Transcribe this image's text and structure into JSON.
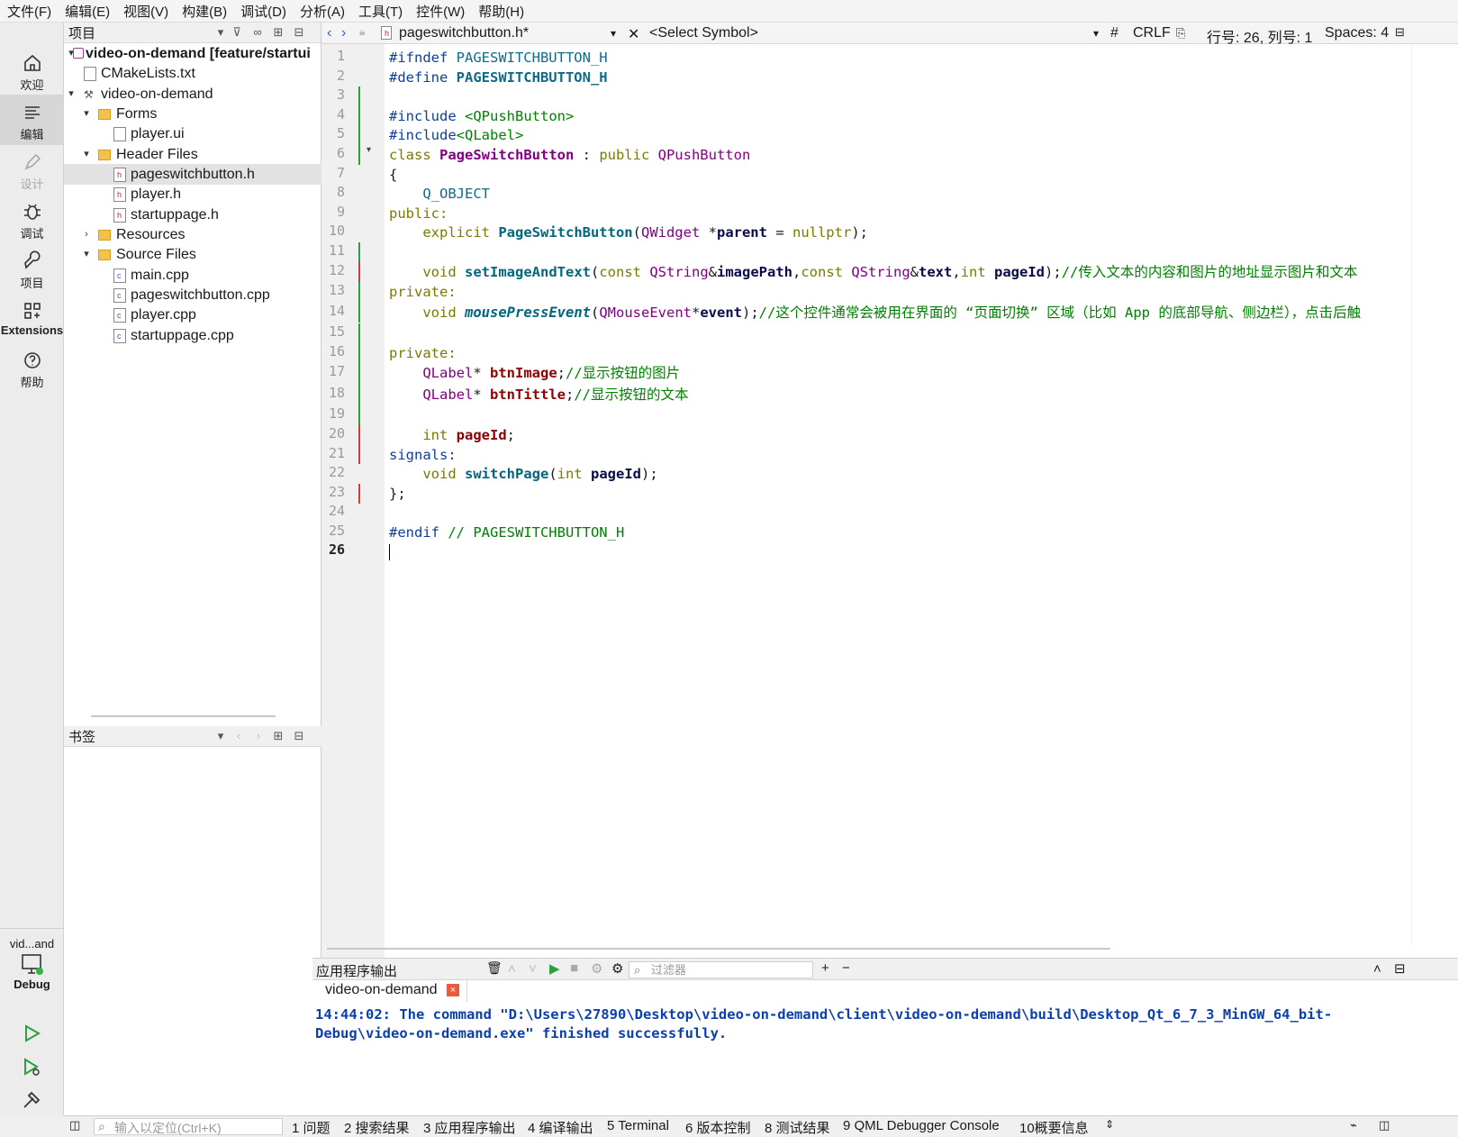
{
  "menu": [
    "文件(F)",
    "编辑(E)",
    "视图(V)",
    "构建(B)",
    "调试(D)",
    "分析(A)",
    "工具(T)",
    "控件(W)",
    "帮助(H)"
  ],
  "modes": [
    {
      "label": "欢迎"
    },
    {
      "label": "编辑"
    },
    {
      "label": "设计"
    },
    {
      "label": "调试"
    },
    {
      "label": "项目"
    },
    {
      "label": "Extensions"
    },
    {
      "label": "帮助"
    }
  ],
  "kit": {
    "project": "vid...and",
    "config": "Debug"
  },
  "project_pane": {
    "title": "项目"
  },
  "tree": [
    {
      "label": "video-on-demand [feature/startui"
    },
    {
      "label": "CMakeLists.txt"
    },
    {
      "label": "video-on-demand"
    },
    {
      "label": "Forms"
    },
    {
      "label": "player.ui"
    },
    {
      "label": "Header Files"
    },
    {
      "label": "pageswitchbutton.h"
    },
    {
      "label": "player.h"
    },
    {
      "label": "startuppage.h"
    },
    {
      "label": "Resources"
    },
    {
      "label": "Source Files"
    },
    {
      "label": "main.cpp"
    },
    {
      "label": "pageswitchbutton.cpp"
    },
    {
      "label": "player.cpp"
    },
    {
      "label": "startuppage.cpp"
    }
  ],
  "bookmarks": {
    "title": "书签"
  },
  "editor": {
    "file": "pageswitchbutton.h*",
    "symbol": "<Select Symbol>",
    "hash": "#",
    "eol": "CRLF",
    "position": "行号: 26, 列号: 1",
    "spaces": "Spaces: 4"
  },
  "lines": [
    "1",
    "2",
    "3",
    "4",
    "5",
    "6",
    "7",
    "8",
    "9",
    "10",
    "11",
    "12",
    "13",
    "14",
    "15",
    "16",
    "17",
    "18",
    "19",
    "20",
    "21",
    "22",
    "23",
    "24",
    "25",
    "26"
  ],
  "code": {
    "l1a": "#ifndef ",
    "l1b": "PAGESWITCHBUTTON_H",
    "l2a": "#define ",
    "l2b": "PAGESWITCHBUTTON_H",
    "l4a": "#include ",
    "l4b": "<QPushButton>",
    "l5a": "#include",
    "l5b": "<QLabel>",
    "l6a": "class ",
    "l6b": "PageSwitchButton",
    " l6c": " : ",
    "l6d": "public ",
    "l6e": "QPushButton",
    "l7": "{",
    "l8": "    Q_OBJECT",
    "l9": "public:",
    "l10a": "    explicit ",
    "l10b": "PageSwitchButton",
    "l10c": "(",
    "l10d": "QWidget",
    " l10e": " *",
    "l10f": "parent",
    " l10g": " = ",
    "l10h": "nullptr",
    "l10i": ");",
    "l12a": "    void ",
    "l12b": "setImageAndText",
    "l12c": "(",
    "l12d": "const ",
    "l12e": "QString",
    "l12f": "&",
    "l12g": "imagePath",
    "l12h": ",",
    "l12i": "const ",
    "l12j": "QString",
    "l12k": "&",
    "l12l": "text",
    "l12m": ",",
    "l12n": "int ",
    "l12o": "pageId",
    "l12p": ");",
    "l12q": "//传入文本的内容和图片的地址显示图片和文本",
    "l13": "private:",
    "l14a": "    void ",
    "l14b": "mousePressEvent",
    "l14c": "(",
    "l14d": "QMouseEvent",
    "l14e": "*",
    "l14f": "event",
    "l14g": ");",
    "l14h": "//这个控件通常会被用在界面的 “页面切换” 区域（比如 App 的底部导航、侧边栏），点击后触",
    "l16": "private:",
    "l17a": "    QLabel",
    "l17b": "* ",
    "l17c": "btnImage",
    "l17d": ";",
    "l17e": "//显示按钮的图片",
    "l18a": "    QLabel",
    "l18b": "* ",
    "l18c": "btnTittle",
    "l18d": ";",
    "l18e": "//显示按钮的文本",
    "l20a": "    int ",
    "l20b": "pageId",
    "l20c": ";",
    "l21": "signals:",
    "l22a": "    void ",
    "l22b": "switchPage",
    "l22c": "(",
    "l22d": "int ",
    "l22e": "pageId",
    "l22f": ");",
    "l23": "};",
    "l25a": "#endif ",
    "l25b": "// PAGESWITCHBUTTON_H"
  },
  "output": {
    "title": "应用程序输出",
    "filter_placeholder": "过滤器",
    "tab": "video-on-demand",
    "line1": "14:44:02: The command \"D:\\Users\\27890\\Desktop\\video-on-demand\\client\\video-on-demand\\build\\Desktop_Qt_6_7_3_MinGW_64_bit-",
    "line2": "Debug\\video-on-demand.exe\" finished successfully."
  },
  "status": {
    "locator": "输入以定位(Ctrl+K)",
    "tabs": [
      "1 问题",
      "2 搜索结果",
      "3 应用程序输出",
      "4 编译输出",
      "5 Terminal",
      "6 版本控制",
      "8 测试结果",
      "9 QML Debugger Console",
      "10概要信息"
    ]
  },
  "colors": {
    "accent": "#2f9e3f",
    "keyword": "#7a7a00",
    "type": "#810081",
    "comment": "#008000",
    "output": "#0a3fb0"
  }
}
